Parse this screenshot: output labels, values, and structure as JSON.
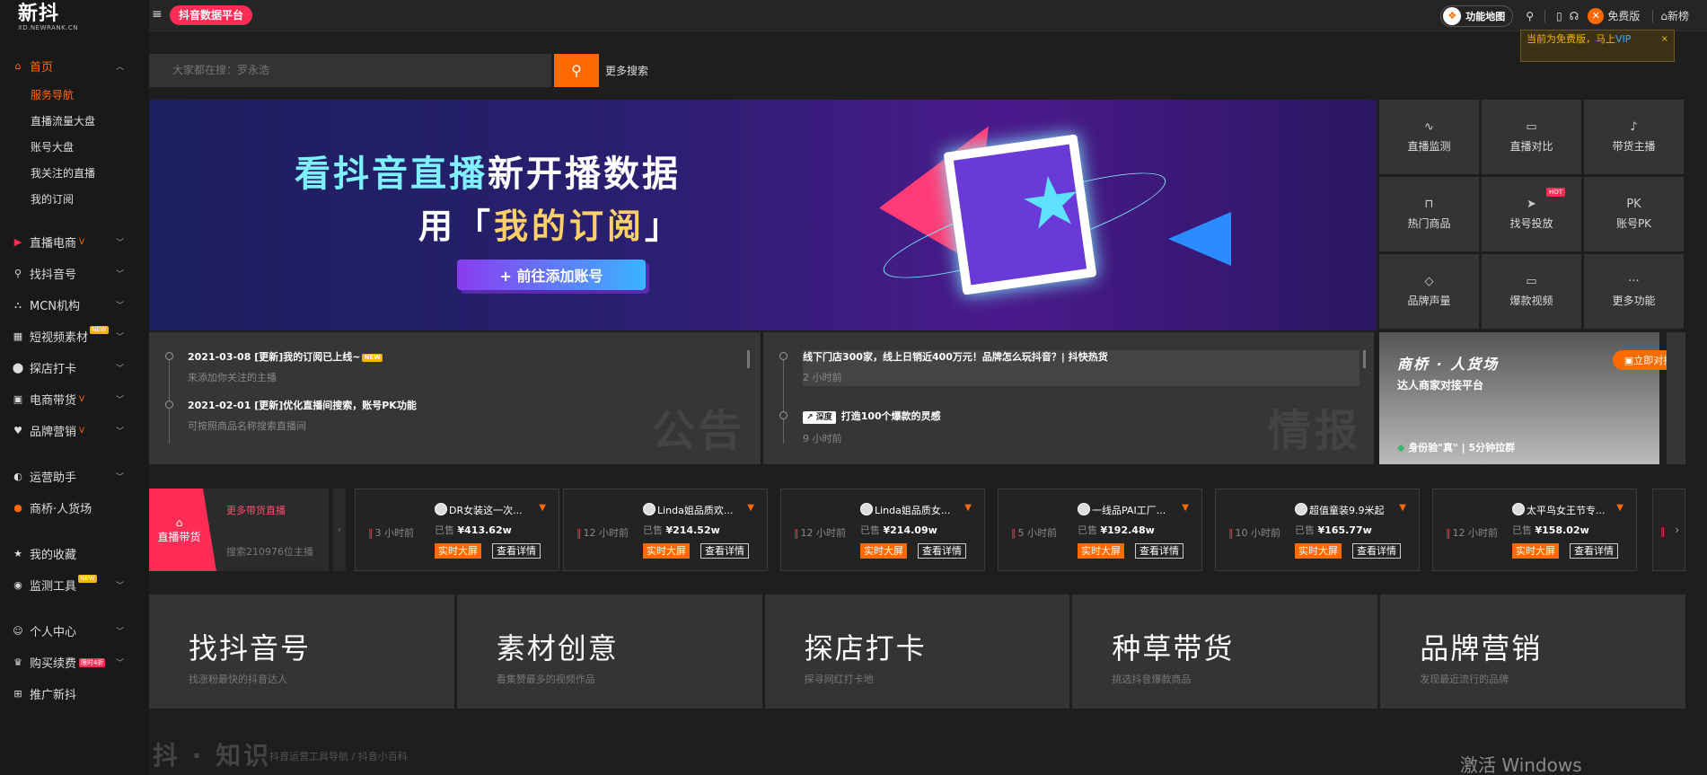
{
  "app": {
    "logo_main": "新抖",
    "logo_sub": "XD.NEWRANK.CN",
    "platform": "抖音数据平台"
  },
  "topbar": {
    "feature_map": "功能地图",
    "free_version": "免费版",
    "xinbang": "新榜"
  },
  "vip_tip": {
    "text": "当前为免费版，马上",
    "vip": "VIP",
    "close": "×"
  },
  "search": {
    "placeholder": "大家都在搜：罗永浩",
    "more": "更多搜索"
  },
  "sidebar": {
    "home": "首页",
    "home_children": [
      "服务导航",
      "直播流量大盘",
      "账号大盘",
      "我关注的直播",
      "我的订阅"
    ],
    "items": [
      {
        "label": "直播电商"
      },
      {
        "label": "找抖音号"
      },
      {
        "label": "MCN机构"
      },
      {
        "label": "短视频素材",
        "tag": "NEW"
      },
      {
        "label": "探店打卡"
      },
      {
        "label": "电商带货"
      },
      {
        "label": "品牌营销"
      },
      {
        "label": "运营助手"
      },
      {
        "label": "商桥·人货场"
      },
      {
        "label": "我的收藏"
      },
      {
        "label": "监测工具",
        "tag": "NEW"
      },
      {
        "label": "个人中心"
      },
      {
        "label": "购买续费",
        "tag": "限时4折"
      },
      {
        "label": "推广新抖"
      }
    ]
  },
  "banner": {
    "line1_a": "看抖音直播",
    "line1_b": "新开播数据",
    "line2_a": "用「",
    "line2_b": "我的订阅",
    "line2_c": "」",
    "button": "+ 前往添加账号"
  },
  "grid": [
    {
      "label": "直播监测",
      "icon": "pulse-icon"
    },
    {
      "label": "直播对比",
      "icon": "compare-icon"
    },
    {
      "label": "带货主播",
      "icon": "mic-icon"
    },
    {
      "label": "热门商品",
      "icon": "bag-icon"
    },
    {
      "label": "找号投放",
      "icon": "send-icon",
      "hot": "HOT"
    },
    {
      "label": "账号PK",
      "icon": "pk-icon"
    },
    {
      "label": "品牌声量",
      "icon": "diamond-icon"
    },
    {
      "label": "爆款视频",
      "icon": "video-icon"
    },
    {
      "label": "更多功能",
      "icon": "more-icon"
    }
  ],
  "announcements": {
    "watermark": "公告",
    "items": [
      {
        "title": "2021-03-08 [更新]我的订阅已上线~",
        "tag": "NEW",
        "sub": "来添加你关注的主播"
      },
      {
        "title": "2021-02-01 [更新]优化直播间搜索，账号PK功能",
        "sub": "可按照商品名称搜索直播间"
      }
    ]
  },
  "intel": {
    "watermark": "情报",
    "items": [
      {
        "title": "线下门店300家，线上日销近400万元！品牌怎么玩抖音？| 抖快热货",
        "sub": "2 小时前"
      },
      {
        "badge": "深度",
        "title": "打造100个爆款的灵感",
        "sub": "9 小时前"
      }
    ]
  },
  "promo": {
    "title": "商桥 · 人货场",
    "sub": "达人商家对接平台",
    "button": "立即对接",
    "foot": "身份验\"真\" | 5分钟拉群"
  },
  "live": {
    "badge": "直播带货",
    "more": "更多带货直播",
    "search": "搜索210976位主播"
  },
  "cards": [
    {
      "time": "3 小时前",
      "name": "DR女装这一次...",
      "sold_label": "已售",
      "sold": "¥413.62w"
    },
    {
      "time": "12 小时前",
      "name": "Linda姐品质欢...",
      "sold_label": "已售",
      "sold": "¥214.52w"
    },
    {
      "time": "12 小时前",
      "name": "Linda姐品质女...",
      "sold_label": "已售",
      "sold": "¥214.09w"
    },
    {
      "time": "5 小时前",
      "name": "一线品PAI工厂...",
      "sold_label": "已售",
      "sold": "¥192.48w"
    },
    {
      "time": "10 小时前",
      "name": "超值童装9.9米起",
      "sold_label": "已售",
      "sold": "¥165.77w"
    },
    {
      "time": "12 小时前",
      "name": "太平鸟女王节专...",
      "sold_label": "已售",
      "sold": "¥158.02w"
    }
  ],
  "card_buttons": {
    "screen": "实时大屏",
    "detail": "查看详情"
  },
  "categories": [
    {
      "title": "找抖音号",
      "sub": "找涨粉最快的抖音达人"
    },
    {
      "title": "素材创意",
      "sub": "看集赞最多的视频作品"
    },
    {
      "title": "探店打卡",
      "sub": "探寻网红打卡地"
    },
    {
      "title": "种草带货",
      "sub": "挑选抖音爆款商品"
    },
    {
      "title": "品牌营销",
      "sub": "发现最近流行的品牌"
    }
  ],
  "knowledge": {
    "title": "抖 · 知识",
    "sub": "抖音运营工具导航 / 抖音小百科"
  },
  "watermark_os": "激活 Windows",
  "colors": {
    "accent": "#ff6a00",
    "brand": "#ff2d55",
    "bg": "#1e1e1e",
    "panel": "#343434"
  }
}
